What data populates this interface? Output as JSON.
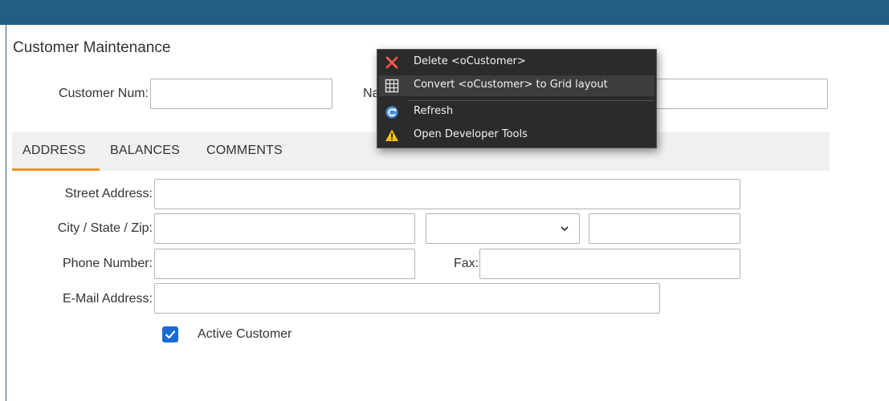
{
  "page": {
    "title": "Customer Maintenance",
    "customer_num_label": "Customer Num:",
    "name_label_partial": "Na"
  },
  "tabs": [
    {
      "label": "ADDRESS",
      "active": true
    },
    {
      "label": "BALANCES",
      "active": false
    },
    {
      "label": "COMMENTS",
      "active": false
    }
  ],
  "address": {
    "street_label": "Street Address:",
    "city_label": "City / State / Zip:",
    "phone_label": "Phone Number:",
    "fax_label": "Fax:",
    "email_label": "E-Mail Address:",
    "street_value": "",
    "city_value": "",
    "state_value": "",
    "zip_value": "",
    "phone_value": "",
    "fax_value": "",
    "email_value": ""
  },
  "active_customer": {
    "label": "Active Customer",
    "checked": true
  },
  "context_menu": {
    "items": [
      {
        "label": "Delete <oCustomer>",
        "icon": "delete-x-icon"
      },
      {
        "label": "Convert <oCustomer> to Grid layout",
        "icon": "grid-icon"
      },
      {
        "label": "Refresh",
        "icon": "refresh-icon"
      },
      {
        "label": "Open Developer Tools",
        "icon": "warning-icon"
      }
    ]
  },
  "colors": {
    "topbar": "#215e83",
    "tab_accent": "#e8962c",
    "checkbox": "#1b6ad6",
    "menu_bg": "#2b2b2b"
  }
}
